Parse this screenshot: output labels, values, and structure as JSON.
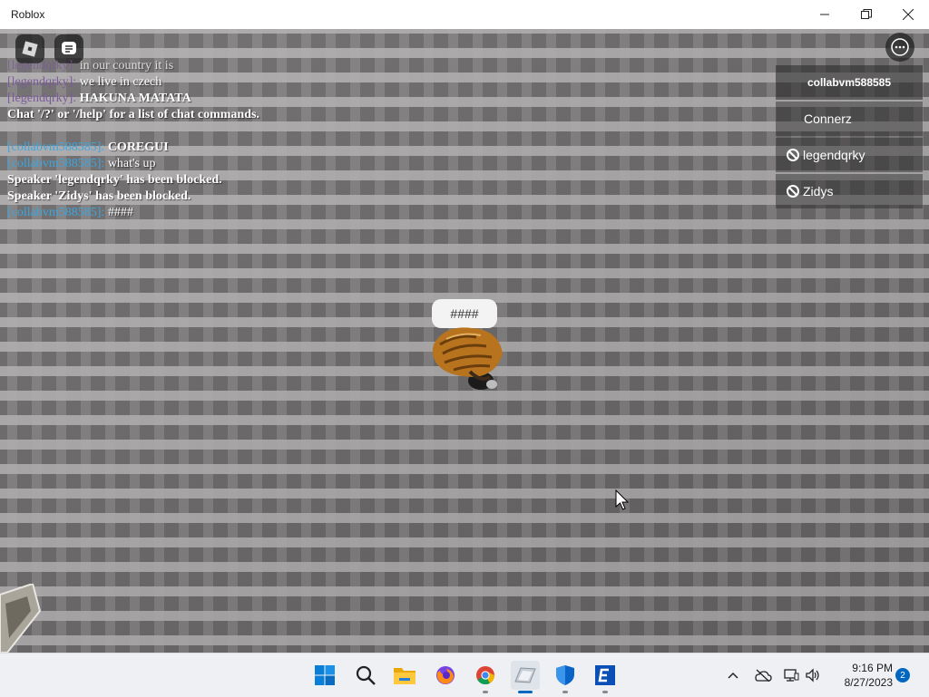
{
  "window": {
    "title": "Roblox"
  },
  "chat": {
    "lines": [
      {
        "speaker": "[legendqrky]:",
        "text": "in our country it is",
        "color": "purple"
      },
      {
        "speaker": "[legendqrky]:",
        "text": "we live in czech",
        "color": "purple"
      },
      {
        "speaker": "[legendqrky]:",
        "text": "HAKUNA MATATA",
        "color": "purple"
      },
      {
        "speaker": "",
        "text": "Chat '/?' or '/help' for a list of chat commands.",
        "color": "system"
      },
      {
        "speaker": "[collabvm588585]:",
        "text": "COREGUI",
        "color": "blue"
      },
      {
        "speaker": "[collabvm588585]:",
        "text": "what's up",
        "color": "blue"
      },
      {
        "speaker": "",
        "text": "Speaker 'legendqrky' has been blocked.",
        "color": "system"
      },
      {
        "speaker": "",
        "text": "Speaker 'Zidys' has been blocked.",
        "color": "system"
      },
      {
        "speaker": "[collabvm588585]:",
        "text": "####",
        "color": "blue"
      }
    ]
  },
  "playerlist": {
    "self": "collabvm588585",
    "players": [
      {
        "name": "Connerz",
        "blocked": false
      },
      {
        "name": "legendqrky",
        "blocked": true
      },
      {
        "name": "Zidys",
        "blocked": true
      }
    ]
  },
  "bubble": {
    "text": "####"
  },
  "taskbar": {
    "time": "9:16 PM",
    "date": "8/27/2023",
    "notifications": "2",
    "icons": [
      "windows-start-icon",
      "search-icon",
      "file-explorer-icon",
      "firefox-icon",
      "chrome-icon",
      "roblox-window-icon",
      "defender-shield-icon",
      "edge-e-icon"
    ]
  },
  "colors": {
    "baseplate": "#7d7a7b",
    "chat_purple": "#7a5a9a",
    "chat_blue": "#3ba6e0",
    "accent": "#0067c0"
  }
}
